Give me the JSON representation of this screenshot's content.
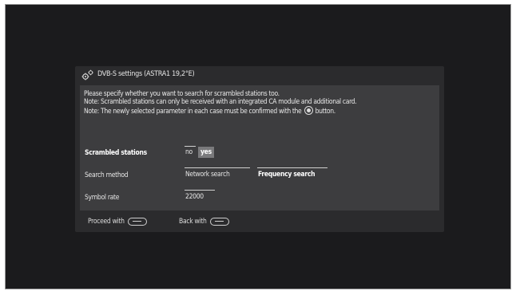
{
  "dialog": {
    "title": "DVB-S settings (ASTRA1 19,2°E)",
    "info_line1": "Please specify whether you want to search for scrambled stations too.",
    "info_line2": "Note: Scrambled stations can only be received with an integrated CA module and additional card.",
    "info_line3_a": "Note: The newly selected parameter in each case must be confirmed with the",
    "info_line3_b": "button."
  },
  "settings": {
    "scrambled": {
      "label": "Scrambled stations",
      "options": [
        "no",
        "yes"
      ],
      "selected": "yes"
    },
    "search_method": {
      "label": "Search method",
      "options": [
        "Network search",
        "Frequency search"
      ],
      "selected": "Frequency search"
    },
    "symbol_rate": {
      "label": "Symbol rate",
      "value": "22000"
    }
  },
  "footer": {
    "proceed": "Proceed with",
    "back": "Back with"
  },
  "icons": {
    "title": "gear-icon",
    "ok": "ok-button-icon",
    "proceed_key": "proceed-key-icon",
    "back_key": "back-key-icon"
  }
}
